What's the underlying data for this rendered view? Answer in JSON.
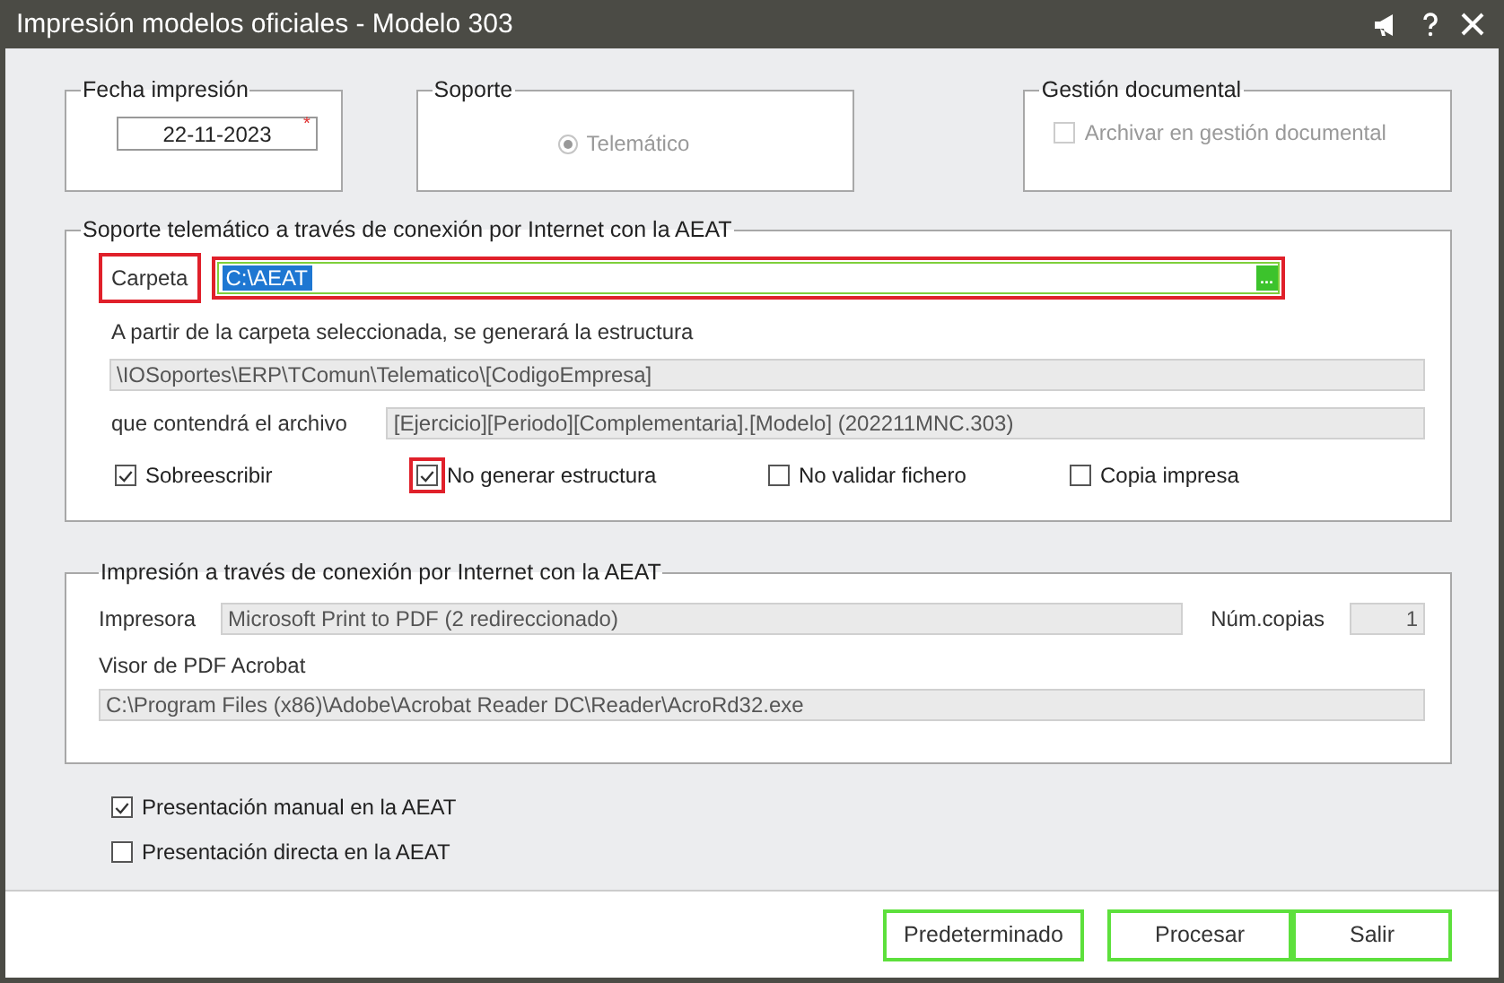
{
  "window": {
    "title": "Impresión modelos oficiales - Modelo 303"
  },
  "fecha": {
    "label": "Fecha impresión",
    "value": "22-11-2023",
    "required_mark": "*"
  },
  "soporte": {
    "label": "Soporte",
    "option": {
      "label": "Telemático",
      "selected": true,
      "disabled": true
    }
  },
  "gestion": {
    "label": "Gestión documental",
    "checkbox": {
      "label": "Archivar en gestión documental",
      "checked": false,
      "disabled": true
    }
  },
  "telematico": {
    "label": "Soporte telemático a través de conexión por Internet con la AEAT",
    "carpeta": {
      "label": "Carpeta",
      "value": "C:\\AEAT",
      "browse": "...",
      "highlighted": true
    },
    "estructura_text": "A partir de la carpeta seleccionada, se generará la estructura",
    "estructura_value": "\\IOSoportes\\ERP\\TComun\\Telematico\\[CodigoEmpresa]",
    "archivo_label": "que contendrá el archivo",
    "archivo_value": "[Ejercicio][Periodo][Complementaria].[Modelo] (202211MNC.303)",
    "options": [
      {
        "label": "Sobreescribir",
        "checked": true,
        "highlighted": false
      },
      {
        "label": "No generar estructura",
        "checked": true,
        "highlighted": true
      },
      {
        "label": "No validar fichero",
        "checked": false,
        "highlighted": false
      },
      {
        "label": "Copia impresa",
        "checked": false,
        "highlighted": false
      }
    ]
  },
  "impresion": {
    "label": "Impresión a través de conexión por Internet con la AEAT",
    "impresora_label": "Impresora",
    "impresora_value": "Microsoft Print to PDF (2 redireccionado)",
    "copias_label": "Núm.copias",
    "copias_value": "1",
    "visor_label": "Visor de PDF Acrobat",
    "visor_value": "C:\\Program Files (x86)\\Adobe\\Acrobat Reader DC\\Reader\\AcroRd32.exe"
  },
  "presentacion": [
    {
      "label": "Presentación manual en la AEAT",
      "checked": true
    },
    {
      "label": "Presentación directa en la AEAT",
      "checked": false
    }
  ],
  "buttons": [
    "Predeterminado",
    "Procesar",
    "Salir"
  ]
}
